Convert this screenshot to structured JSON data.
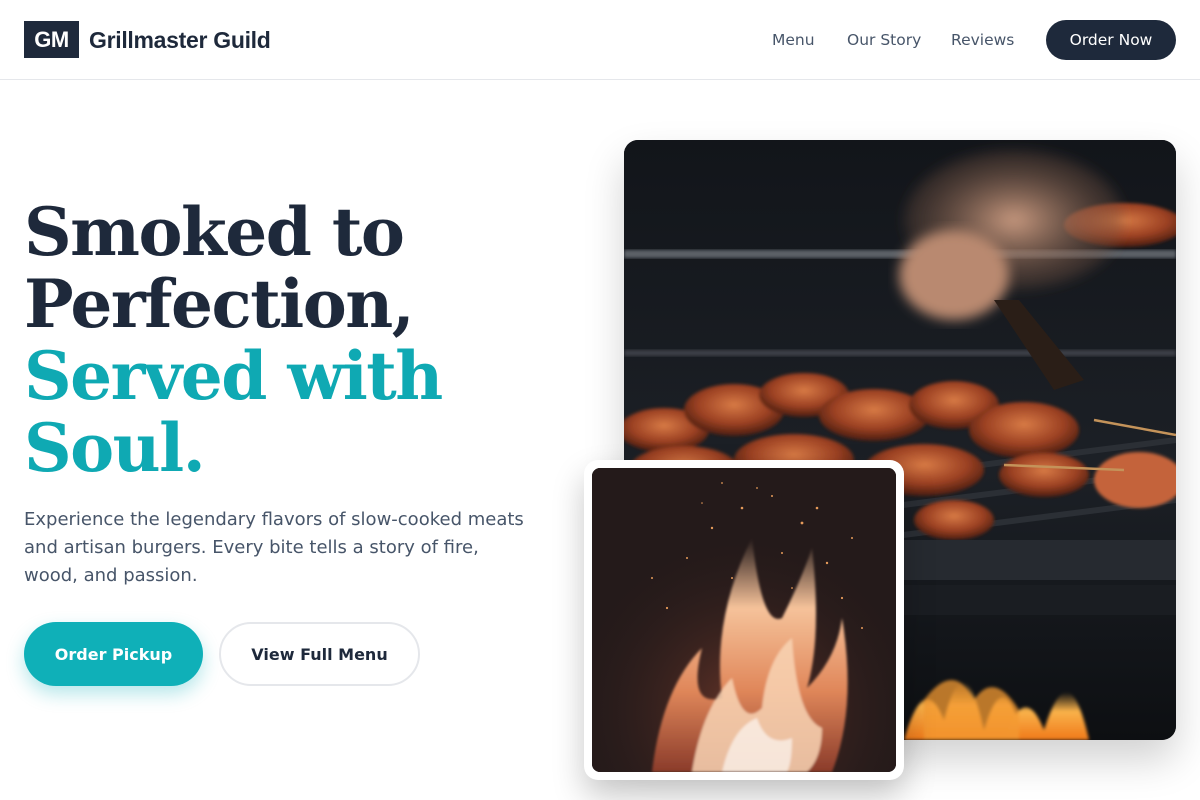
{
  "brand": {
    "logo_initials": "GM",
    "name": "Grillmaster Guild"
  },
  "nav": {
    "items": [
      {
        "label": "Menu"
      },
      {
        "label": "Our Story"
      },
      {
        "label": "Reviews"
      }
    ],
    "cta_label": "Order Now"
  },
  "hero": {
    "title_line1": "Smoked to",
    "title_line2": "Perfection,",
    "title_line3": "Served with",
    "title_line4": "Soul.",
    "subtitle": "Experience the legendary flavors of slow-cooked meats and artisan burgers. Every bite tells a story of fire, wood, and passion.",
    "primary_button": "Order Pickup",
    "secondary_button": "View Full Menu"
  },
  "images": {
    "main": "grill-meat-photo",
    "inset": "fire-flames-photo"
  },
  "colors": {
    "primary_dark": "#1e293b",
    "accent_teal": "#0fa9b3",
    "body_text": "#475569",
    "border": "#e5e7eb"
  }
}
